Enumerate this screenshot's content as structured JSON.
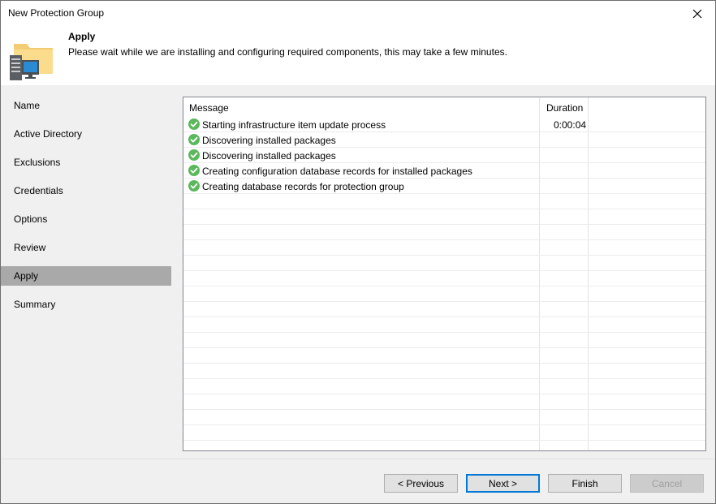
{
  "window": {
    "title": "New Protection Group"
  },
  "header": {
    "title": "Apply",
    "description": "Please wait while we are installing and configuring required components, this may take a few minutes.",
    "icon": "folder-computer-icon"
  },
  "sidebar": {
    "items": [
      {
        "label": "Name",
        "active": false
      },
      {
        "label": "Active Directory",
        "active": false
      },
      {
        "label": "Exclusions",
        "active": false
      },
      {
        "label": "Credentials",
        "active": false
      },
      {
        "label": "Options",
        "active": false
      },
      {
        "label": "Review",
        "active": false
      },
      {
        "label": "Apply",
        "active": true
      },
      {
        "label": "Summary",
        "active": false
      }
    ]
  },
  "log": {
    "columns": {
      "message": "Message",
      "duration": "Duration"
    },
    "rows": [
      {
        "status": "success",
        "message": "Starting infrastructure item update process",
        "duration": "0:00:04"
      },
      {
        "status": "success",
        "message": "Discovering installed packages",
        "duration": ""
      },
      {
        "status": "success",
        "message": "Discovering installed packages",
        "duration": ""
      },
      {
        "status": "success",
        "message": "Creating configuration database records for installed packages",
        "duration": ""
      },
      {
        "status": "success",
        "message": "Creating database records for protection group",
        "duration": ""
      }
    ]
  },
  "footer": {
    "previous": "< Previous",
    "next": "Next >",
    "finish": "Finish",
    "cancel": "Cancel"
  },
  "colors": {
    "success": "#5cb85c",
    "active_nav": "#a9a9a9",
    "accent": "#0078d7"
  }
}
